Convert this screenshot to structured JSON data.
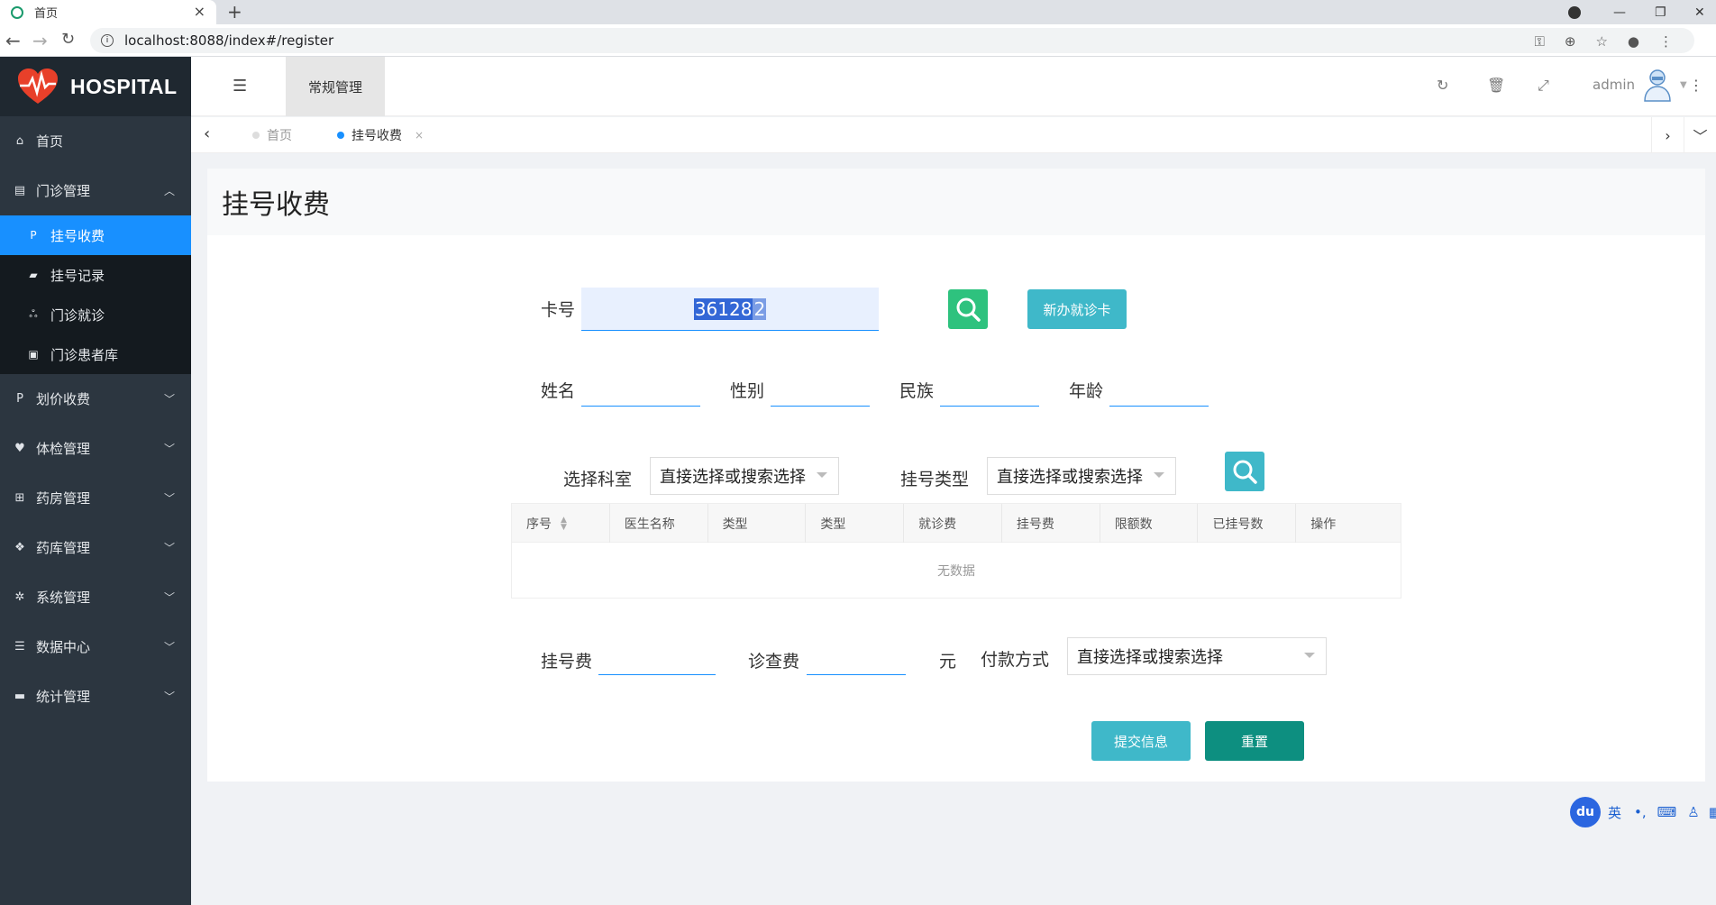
{
  "browser": {
    "tab_title": "首页",
    "url": "localhost:8088/index#/register"
  },
  "sidebar": {
    "brand": "HOSPITAL",
    "items": [
      {
        "label": "首页",
        "icon": "home-icon"
      },
      {
        "label": "门诊管理",
        "icon": "clipboard-icon"
      },
      {
        "label": "划价收费",
        "icon": "paypal-icon"
      },
      {
        "label": "体检管理",
        "icon": "heartbeat-icon"
      },
      {
        "label": "药房管理",
        "icon": "plus-square-icon"
      },
      {
        "label": "药库管理",
        "icon": "cubes-icon"
      },
      {
        "label": "系统管理",
        "icon": "cog-icon"
      },
      {
        "label": "数据中心",
        "icon": "database-icon"
      },
      {
        "label": "统计管理",
        "icon": "comment-icon"
      }
    ],
    "submenu": [
      {
        "label": "挂号收费",
        "icon": "paypal-icon"
      },
      {
        "label": "挂号记录",
        "icon": "book-icon"
      },
      {
        "label": "门诊就诊",
        "icon": "stethoscope-icon"
      },
      {
        "label": "门诊患者库",
        "icon": "address-book-icon"
      }
    ]
  },
  "topbar": {
    "nav_tab": "常规管理",
    "username": "admin"
  },
  "tags": [
    {
      "label": "首页"
    },
    {
      "label": "挂号收费"
    }
  ],
  "page": {
    "title": "挂号收费",
    "card_label": "卡号",
    "card_value": "36128",
    "card_cursor": "2",
    "new_card_button": "新办就诊卡",
    "name_label": "姓名",
    "gender_label": "性别",
    "ethnicity_label": "民族",
    "age_label": "年龄",
    "dept_label": "选择科室",
    "dept_placeholder": "直接选择或搜索选择",
    "reg_type_label": "挂号类型",
    "reg_type_placeholder": "直接选择或搜索选择",
    "table": {
      "headers": [
        "序号",
        "医生名称",
        "类型",
        "类型",
        "就诊费",
        "挂号费",
        "限额数",
        "已挂号数",
        "操作"
      ],
      "empty_text": "无数据"
    },
    "reg_fee_label": "挂号费",
    "exam_fee_label": "诊查费",
    "yuan_label": "元",
    "payment_label": "付款方式",
    "payment_placeholder": "直接选择或搜索选择",
    "submit_button": "提交信息",
    "reset_button": "重置"
  },
  "ime": {
    "logo": "du",
    "mode": "英"
  },
  "colors": {
    "sidebar_bg": "#2c3640",
    "active_blue": "#1890ff",
    "search_green": "#2ec27e",
    "teal_button": "#3fb8c9",
    "reset_button": "#0d8f80"
  }
}
